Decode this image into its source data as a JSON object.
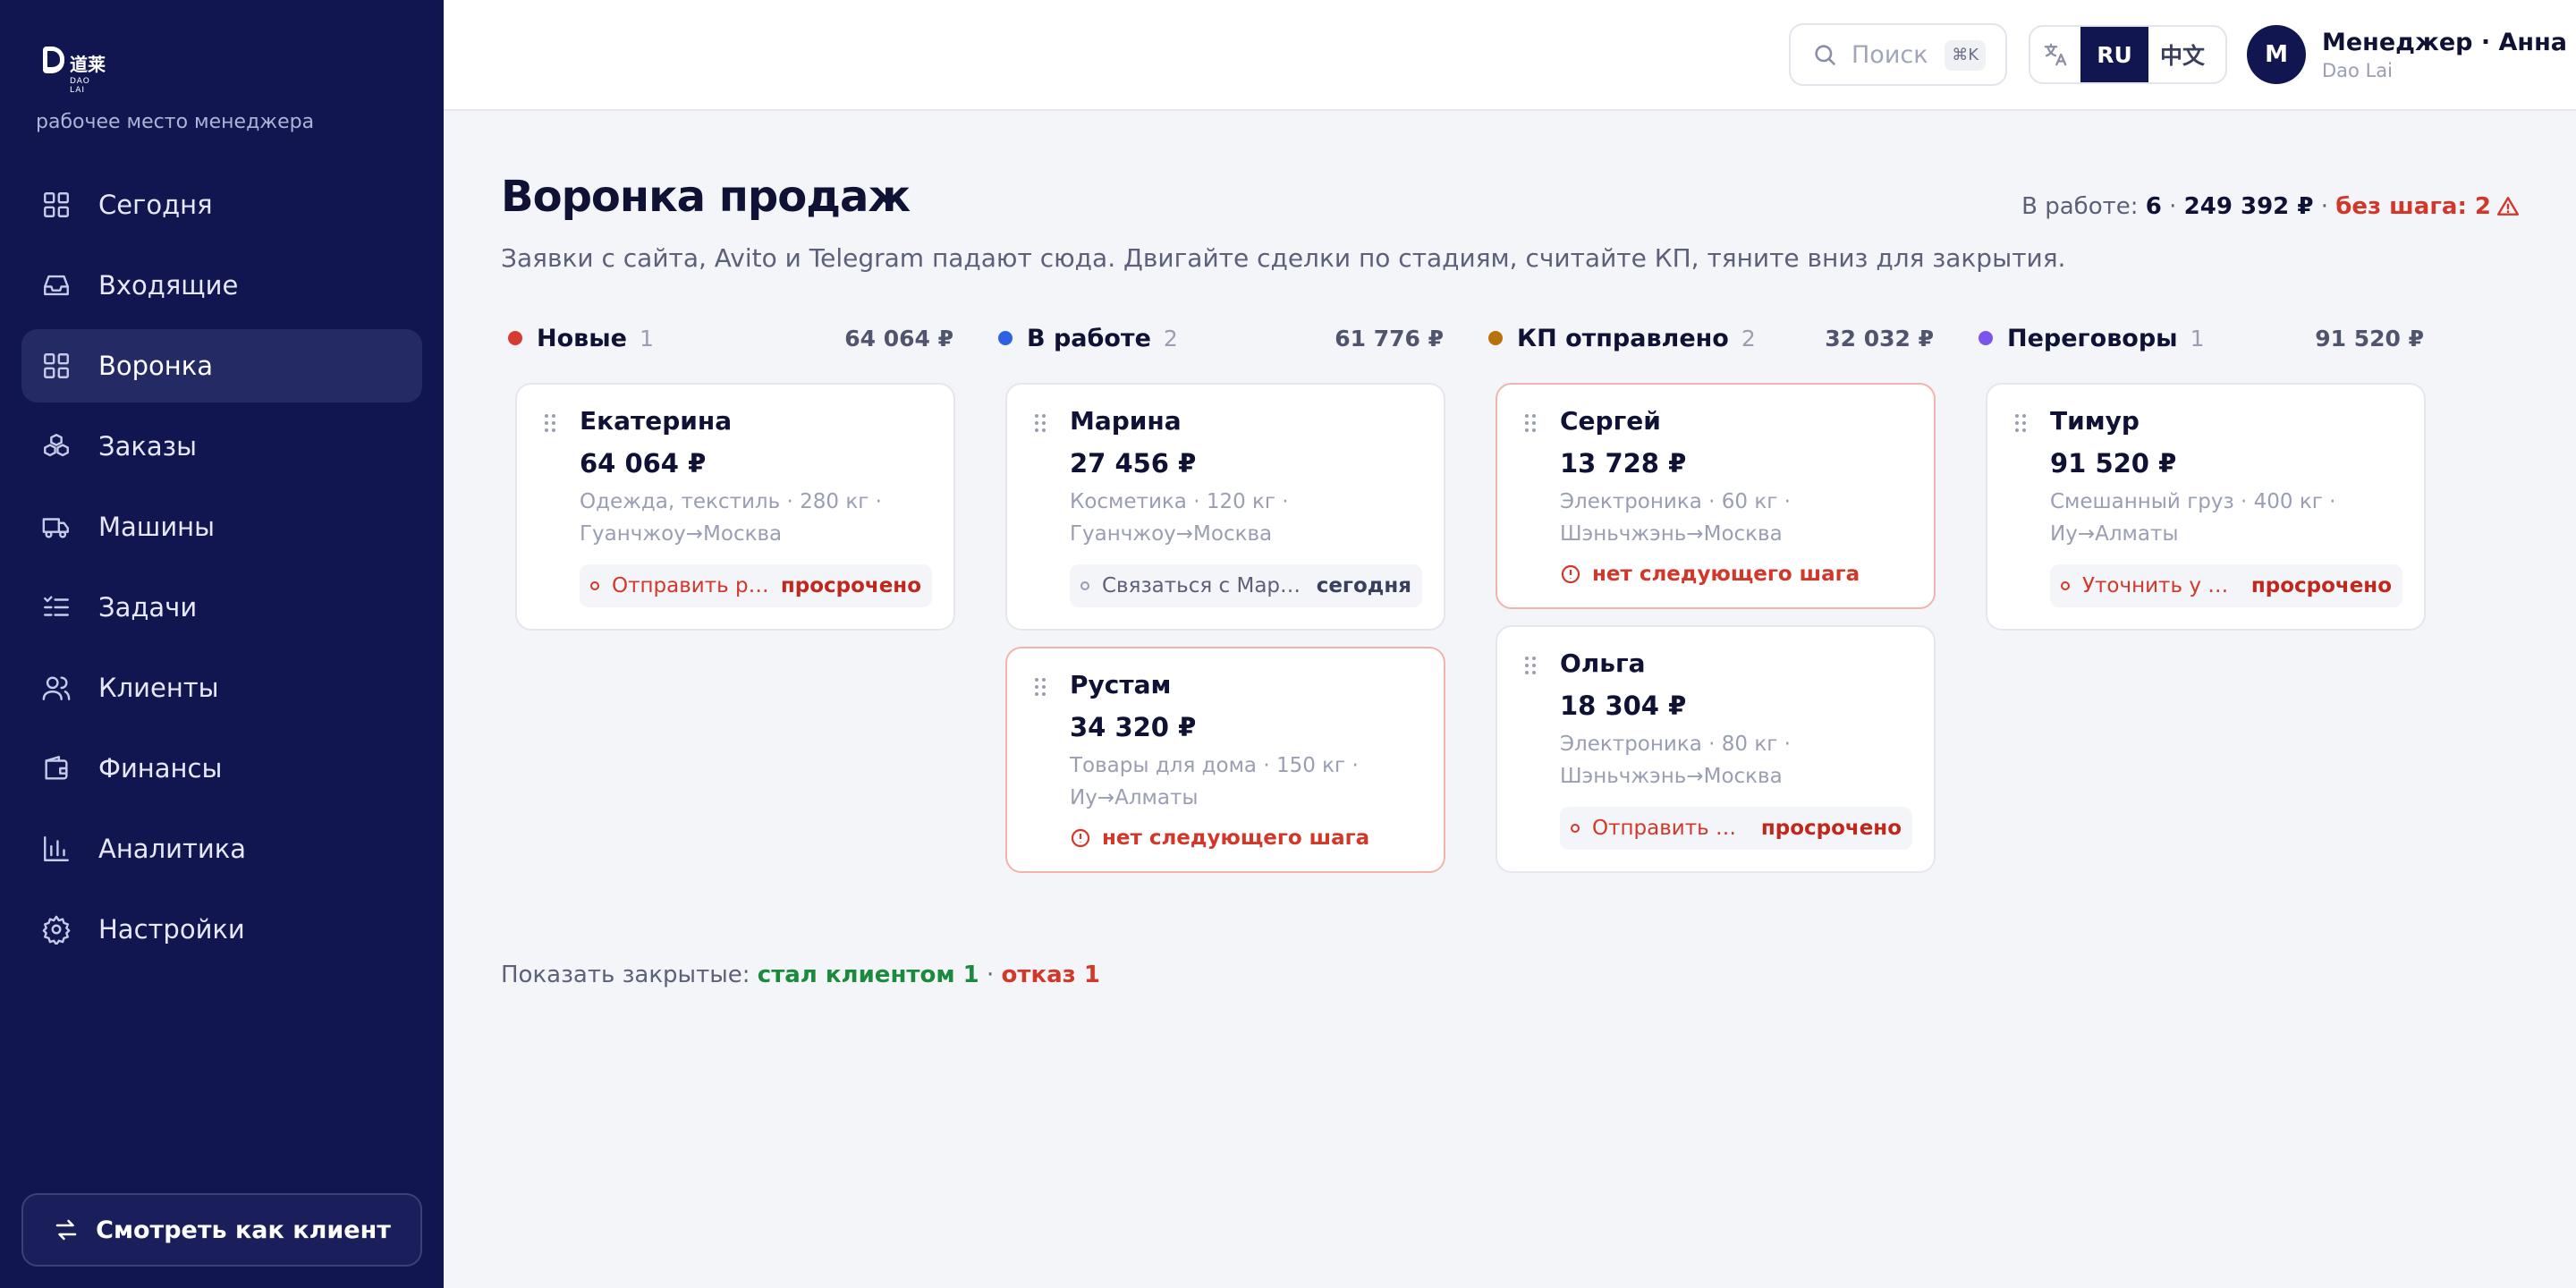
{
  "app": {
    "logo_text": "道莱",
    "logo_sub": "DAO LAI",
    "subtitle": "рабочее место менеджера"
  },
  "sidebar": {
    "items": [
      {
        "label": "Сегодня",
        "icon": "grid-icon",
        "active": false
      },
      {
        "label": "Входящие",
        "icon": "inbox-icon",
        "active": false
      },
      {
        "label": "Воронка",
        "icon": "grid-icon",
        "active": true
      },
      {
        "label": "Заказы",
        "icon": "boxes-icon",
        "active": false
      },
      {
        "label": "Машины",
        "icon": "truck-icon",
        "active": false
      },
      {
        "label": "Задачи",
        "icon": "checklist-icon",
        "active": false
      },
      {
        "label": "Клиенты",
        "icon": "users-icon",
        "active": false
      },
      {
        "label": "Финансы",
        "icon": "wallet-icon",
        "active": false
      },
      {
        "label": "Аналитика",
        "icon": "chart-icon",
        "active": false
      },
      {
        "label": "Настройки",
        "icon": "gear-icon",
        "active": false
      }
    ],
    "view_client_label": "Смотреть как клиент"
  },
  "header": {
    "search": {
      "placeholder": "Поиск",
      "shortcut": "⌘K"
    },
    "languages": [
      "RU",
      "中文"
    ],
    "active_language": "RU",
    "user": {
      "initial": "М",
      "name": "Менеджер · Анна",
      "company": "Dao Lai"
    }
  },
  "page": {
    "title": "Воронка продаж",
    "description": "Заявки с сайта, Avito и Telegram падают сюда. Двигайте сделки по стадиям, считайте КП, тяните вниз для закрытия.",
    "summary": {
      "label": "В работе:",
      "count": "6",
      "sep1": "·",
      "total": "249 392 ₽",
      "sep2": "·",
      "no_step": "без шага: 2"
    }
  },
  "colors": {
    "new": "#d63b30",
    "in_work": "#2e62e0",
    "kp_sent": "#b8720b",
    "negotiation": "#7b55ea",
    "danger": "#d3372a",
    "success": "#1c8a3c",
    "navy": "#111651"
  },
  "columns": [
    {
      "title": "Новые",
      "count": "1",
      "sum": "64 064 ₽",
      "cards": [
        {
          "name": "Екатерина",
          "amount": "64 064 ₽",
          "meta1": "Одежда, текстиль · 280 кг ·",
          "meta2": "Гуанчжоу→Москва",
          "task": "Отправить расчёт",
          "due": "просрочено"
        }
      ]
    },
    {
      "title": "В работе",
      "count": "2",
      "sum": "61 776 ₽",
      "cards": [
        {
          "name": "Марина",
          "amount": "27 456 ₽",
          "meta1": "Косметика · 120 кг ·",
          "meta2": "Гуанчжоу→Москва",
          "task": "Связаться с Мариной",
          "due": "сегодня"
        },
        {
          "name": "Рустам",
          "amount": "34 320 ₽",
          "meta1": "Товары для дома · 150 кг ·",
          "meta2": "Иу→Алматы",
          "no_step": "нет следующего шага"
        }
      ]
    },
    {
      "title": "КП отправлено",
      "count": "2",
      "sum": "32 032 ₽",
      "cards": [
        {
          "name": "Сергей",
          "amount": "13 728 ₽",
          "meta1": "Электроника · 60 кг ·",
          "meta2": "Шэньчжэнь→Москва",
          "no_step": "нет следующего шага"
        },
        {
          "name": "Ольга",
          "amount": "18 304 ₽",
          "meta1": "Электроника · 80 кг ·",
          "meta2": "Шэньчжэнь→Москва",
          "task": "Отправить КП повторно",
          "due": "просрочено"
        }
      ]
    },
    {
      "title": "Переговоры",
      "count": "1",
      "sum": "91 520 ₽",
      "cards": [
        {
          "name": "Тимур",
          "amount": "91 520 ₽",
          "meta1": "Смешанный груз · 400 кг ·",
          "meta2": "Иу→Алматы",
          "task": "Уточнить у Тимура",
          "due": "просрочено"
        }
      ]
    }
  ],
  "closed": {
    "label": "Показать закрытые:",
    "won": "стал клиентом 1",
    "sep": "·",
    "lost": "отказ 1"
  }
}
